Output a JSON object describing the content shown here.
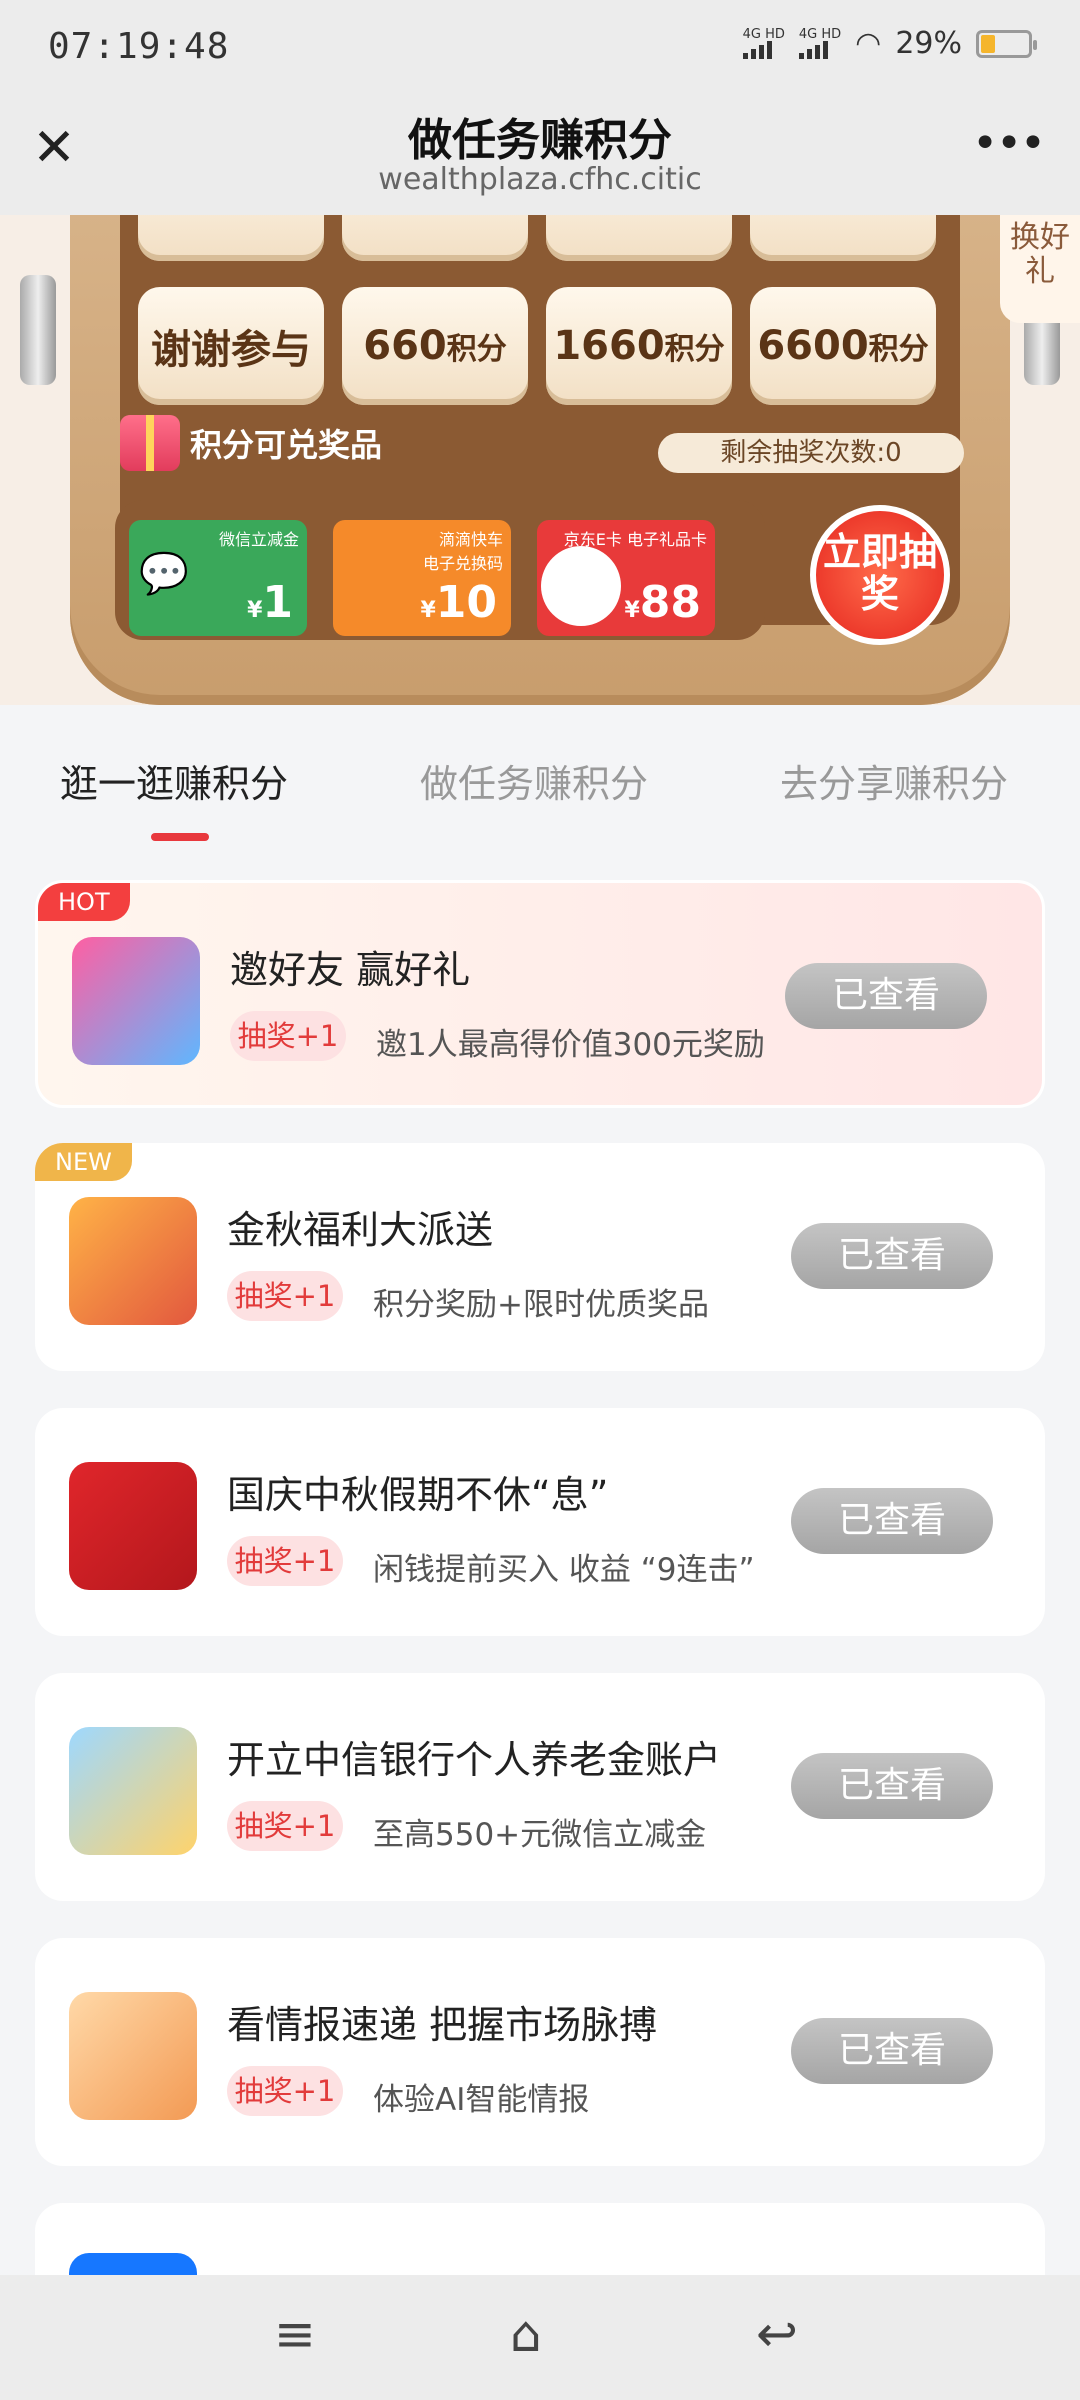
{
  "status_bar": {
    "time": "07:19:48",
    "net1": "4G HD",
    "net2": "4G HD",
    "battery": "29%"
  },
  "titlebar": {
    "title": "做任务赚积分",
    "url": "wealthplaza.cfhc.citic"
  },
  "machine": {
    "cells": [
      {
        "label": "谢谢参与",
        "unit": ""
      },
      {
        "label": "660",
        "unit": "积分"
      },
      {
        "label": "1660",
        "unit": "积分"
      },
      {
        "label": "6600",
        "unit": "积分"
      }
    ],
    "side_label": "换好礼",
    "prize_label": "积分可兑奖品",
    "remaining": "剩余抽奖次数:0",
    "prizes": [
      {
        "title": "微信立减金",
        "value": "1",
        "color": "#3aa85a"
      },
      {
        "title": "滴滴快车 电子兑换码",
        "value": "10",
        "color": "#f58a2a"
      },
      {
        "title": "京东E卡 电子礼品卡",
        "value": "88",
        "color": "#e83a3a"
      }
    ],
    "draw_button": "立即抽奖"
  },
  "tabs": [
    "逛一逛赚积分",
    "做任务赚积分",
    "去分享赚积分"
  ],
  "tasks": [
    {
      "badge": "HOT",
      "title": "邀好友 赢好礼",
      "tag": "抽奖+1",
      "desc": "邀1人最高得价值300元奖励",
      "button": "已查看",
      "icon": "weekly-lottery-icon"
    },
    {
      "badge": "NEW",
      "title": "金秋福利大派送",
      "tag": "抽奖+1",
      "desc": "积分奖励+限时优质奖品",
      "button": "已查看",
      "icon": "gift-bag-icon"
    },
    {
      "badge": "",
      "title": "国庆中秋假期不休“息”",
      "tag": "抽奖+1",
      "desc": "闲钱提前买入 收益 “9连击”",
      "button": "已查看",
      "icon": "huaxia-fund-icon"
    },
    {
      "badge": "",
      "title": "开立中信银行个人养老金账户",
      "tag": "抽奖+1",
      "desc": "至高550+元微信立减金",
      "button": "已查看",
      "icon": "money-bag-icon"
    },
    {
      "badge": "",
      "title": "看情报速递 把握市场脉搏",
      "tag": "抽奖+1",
      "desc": "体验AI智能情报",
      "button": "已查看",
      "icon": "intelligence-news-icon"
    }
  ]
}
